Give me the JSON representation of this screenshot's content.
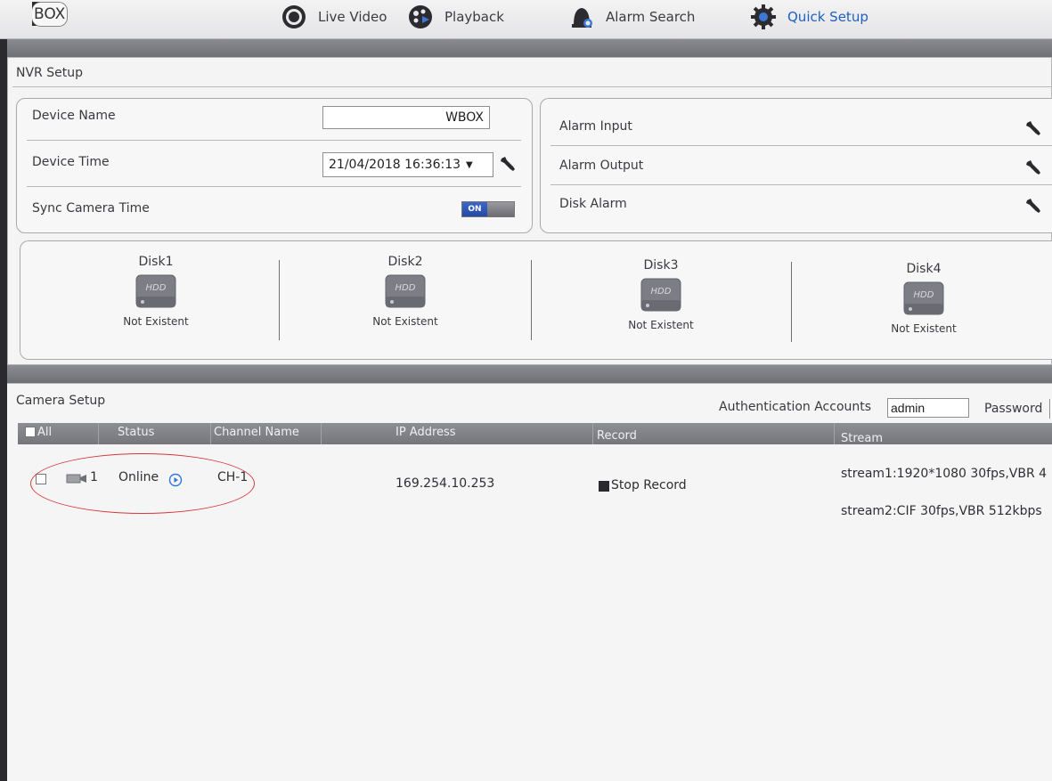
{
  "brand": {
    "letter": "W",
    "rest": "BOX"
  },
  "nav": [
    {
      "label": "Live Video",
      "icon": "live-video-icon",
      "active": false
    },
    {
      "label": "Playback",
      "icon": "playback-icon",
      "active": false
    },
    {
      "label": "Alarm Search",
      "icon": "alarm-search-icon",
      "active": false
    },
    {
      "label": "Quick Setup",
      "icon": "gear-icon",
      "active": true
    }
  ],
  "nvr": {
    "title": "NVR Setup",
    "device_name_label": "Device Name",
    "device_name_value": "WBOX",
    "device_time_label": "Device Time",
    "device_time_value": "21/04/2018 16:36:13",
    "sync_label": "Sync Camera Time",
    "sync_state": "ON",
    "alarm_input_label": "Alarm Input",
    "alarm_output_label": "Alarm Output",
    "disk_alarm_label": "Disk Alarm"
  },
  "disks": [
    {
      "name": "Disk1",
      "badge": "HDD",
      "status": "Not Existent"
    },
    {
      "name": "Disk2",
      "badge": "HDD",
      "status": "Not Existent"
    },
    {
      "name": "Disk3",
      "badge": "HDD",
      "status": "Not Existent"
    },
    {
      "name": "Disk4",
      "badge": "HDD",
      "status": "Not Existent"
    }
  ],
  "camera": {
    "title": "Camera Setup",
    "auth_label": "Authentication Accounts",
    "auth_value": "admin",
    "password_label": "Password",
    "columns": {
      "all": "All",
      "status": "Status",
      "channel_name": "Channel Name",
      "ip": "IP Address",
      "record": "Record",
      "stream": "Stream"
    },
    "rows": [
      {
        "index": "1",
        "status": "Online",
        "channel": "CH-1",
        "ip": "169.254.10.253",
        "record": "Stop Record",
        "stream1": "stream1:1920*1080 30fps,VBR 4",
        "stream2": "stream2:CIF 30fps,VBR 512kbps"
      }
    ]
  },
  "colors": {
    "accent": "#1f5fbf",
    "annotation": "#d4373a",
    "toggle_on": "#2f55b6"
  }
}
